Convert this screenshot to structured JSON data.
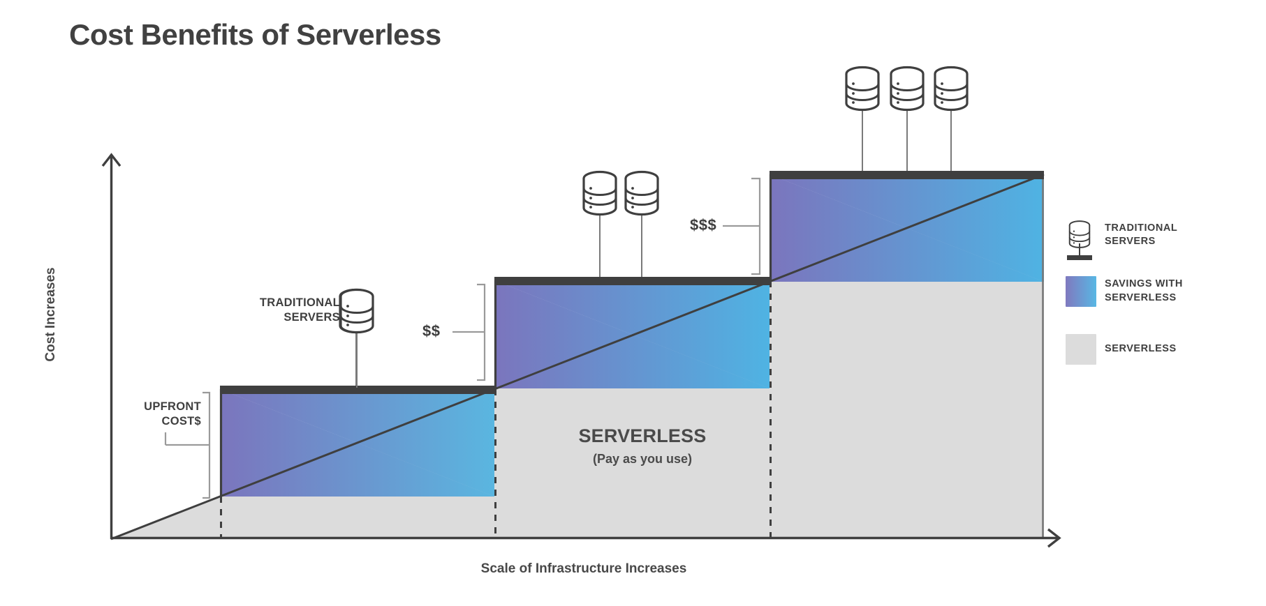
{
  "title": "Cost Benefits of Serverless",
  "axes": {
    "y_label": "Cost Increases",
    "x_label": "Scale of Infrastructure Increases"
  },
  "annotations": {
    "upfront_line1": "UPFRONT",
    "upfront_line2": "COST$",
    "tier2_cost": "$$",
    "tier3_cost": "$$$",
    "traditional_line1": "TRADITIONAL",
    "traditional_line2": "SERVERS",
    "serverless_title": "SERVERLESS",
    "serverless_sub": "(Pay as you use)"
  },
  "legend": {
    "items": [
      {
        "icon": "server-stack-icon",
        "line1": "TRADITIONAL",
        "line2": "SERVERS",
        "color": "#3f3f3f"
      },
      {
        "icon": "gradient-swatch",
        "line1": "SAVINGS WITH",
        "line2": "SERVERLESS",
        "color": "#7b75bd"
      },
      {
        "icon": "gray-swatch",
        "line1": "SERVERLESS",
        "line2": "",
        "color": "#dcdcdc"
      }
    ]
  },
  "colors": {
    "gradient_start": "#7b75bd",
    "gradient_end": "#5ab6e0",
    "serverless_fill": "#dcdcdc",
    "stroke": "#3f3f3f",
    "slab": "#3f3f3f",
    "text": "#414141"
  },
  "chart_data": {
    "type": "area",
    "title": "Cost Benefits of Serverless",
    "xlabel": "Scale of Infrastructure Increases",
    "ylabel": "Cost Increases",
    "grid": false,
    "legend_position": "right",
    "description": "Step function of traditional server capacity versus a linear serverless pay-as-you-use cost line; the wedge between them is the savings.",
    "series": [
      {
        "name": "TRADITIONAL SERVERS",
        "type": "step",
        "x": [
          0,
          1,
          1,
          2,
          2,
          3,
          3
        ],
        "y": [
          0,
          0,
          1,
          1,
          2,
          2,
          3
        ],
        "steps": [
          {
            "index": 1,
            "x_start": 1,
            "x_end": 2,
            "level": 1,
            "servers": 1,
            "cost_label": "UPFRONT COST$"
          },
          {
            "index": 2,
            "x_start": 2,
            "x_end": 3,
            "level": 2,
            "servers": 2,
            "cost_label": "$$"
          },
          {
            "index": 3,
            "x_start": 3,
            "x_end": 4,
            "level": 3,
            "servers": 3,
            "cost_label": "$$$"
          }
        ]
      },
      {
        "name": "SERVERLESS",
        "type": "line",
        "x": [
          0,
          4
        ],
        "y": [
          0,
          3
        ],
        "note": "Pay as you use"
      },
      {
        "name": "SAVINGS WITH SERVERLESS",
        "type": "area-between",
        "between": [
          "TRADITIONAL SERVERS",
          "SERVERLESS"
        ]
      }
    ],
    "xlim": [
      0,
      4
    ],
    "ylim": [
      0,
      3.3
    ],
    "xticks": [],
    "yticks": []
  }
}
